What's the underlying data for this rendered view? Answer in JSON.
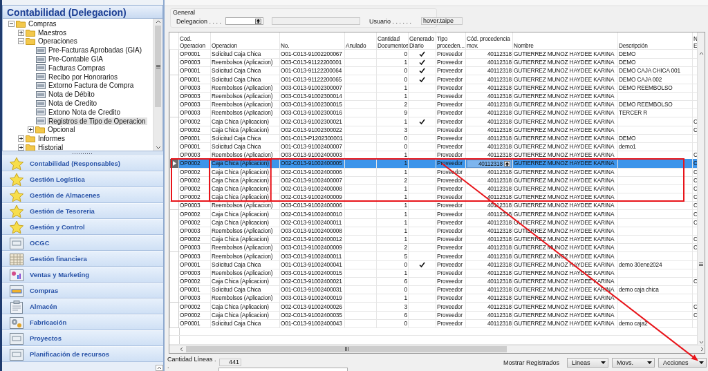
{
  "sidebar": {
    "title": "Contabilidad (Delegacion)",
    "tree": [
      {
        "label": "Compras",
        "kind": "folder",
        "expanded": true,
        "selected": false,
        "children": [
          {
            "label": "Maestros",
            "kind": "folder",
            "expanded": false,
            "selected": false
          },
          {
            "label": "Operaciones",
            "kind": "folder",
            "expanded": true,
            "selected": false,
            "children": [
              {
                "label": "Pre-Facturas Aprobadas (GIA)",
                "kind": "form",
                "selected": false
              },
              {
                "label": "Pre-Contable GIA",
                "kind": "form",
                "selected": false
              },
              {
                "label": "Facturas Compras",
                "kind": "form",
                "selected": false
              },
              {
                "label": "Recibo por Honorarios",
                "kind": "form",
                "selected": false
              },
              {
                "label": "Extorno Factura de Compra",
                "kind": "form",
                "selected": false
              },
              {
                "label": "Nota de Débito",
                "kind": "form",
                "selected": false
              },
              {
                "label": "Nota de Credito",
                "kind": "form",
                "selected": false
              },
              {
                "label": "Extono Nota de Credito",
                "kind": "form",
                "selected": false
              },
              {
                "label": "Registros de Tipo de Operacion",
                "kind": "form",
                "selected": true
              },
              {
                "label": "Opcional",
                "kind": "folder",
                "expanded": false,
                "selected": false
              }
            ]
          },
          {
            "label": "Informes",
            "kind": "folder",
            "expanded": false,
            "selected": false
          },
          {
            "label": "Historial",
            "kind": "folder",
            "expanded": false,
            "selected": false
          }
        ]
      }
    ],
    "nav": [
      {
        "label": "Contabilidad (Responsables)",
        "kind": "star"
      },
      {
        "label": "Gestión Logística",
        "kind": "star"
      },
      {
        "label": "Gestión de Almacenes",
        "kind": "star"
      },
      {
        "label": "Gestión de Tesoreria",
        "kind": "star"
      },
      {
        "label": "Gestión y Control",
        "kind": "star"
      },
      {
        "label": "OCGC",
        "kind": "form"
      },
      {
        "label": "Gestión financiera",
        "kind": "grid"
      },
      {
        "label": "Ventas y Marketing",
        "kind": "chart"
      },
      {
        "label": "Compras",
        "kind": "tray"
      },
      {
        "label": "Almacén",
        "kind": "clipboard"
      },
      {
        "label": "Fabricación",
        "kind": "gear"
      },
      {
        "label": "Proyectos",
        "kind": "form"
      },
      {
        "label": "Planificación de recursos",
        "kind": "form"
      }
    ]
  },
  "general": {
    "title": "General",
    "delegacion_label": "Delegacion . . . .",
    "usuario_label": "Usuario . . . . . .",
    "usuario": "hover.taipe"
  },
  "table": {
    "columns": [
      {
        "label": "Cod.\nOperacion",
        "marked": false
      },
      {
        "label": "Operacion",
        "marked": true
      },
      {
        "label": "No.",
        "marked": false
      },
      {
        "label": "Anulado",
        "marked": false
      },
      {
        "label": "Cantidad\nDocumentos",
        "marked": false
      },
      {
        "label": "Generado\nDiario",
        "marked": false
      },
      {
        "label": "Tipo\nproceden...",
        "marked": false
      },
      {
        "label": "Cód. procedencia\nmov.",
        "marked": false
      },
      {
        "label": "Nombre",
        "marked": false
      },
      {
        "label": "Descripción",
        "marked": false
      },
      {
        "label": "N\nE",
        "marked": false
      }
    ],
    "rows": [
      {
        "code": "OP0001",
        "operacion": "Solicitud Caja Chica",
        "no": "O01-C013-91002200067",
        "cantidad": "0",
        "generado_diario": true,
        "tipo": "Proveedor",
        "cod_procedencia": "40112318",
        "nombre": "GUTIERREZ MUNOZ HAYDEE KARINA",
        "descripcion": "DEMO",
        "selected": false,
        "marked": false
      },
      {
        "code": "OP0003",
        "operacion": "Reembolsos (Aplicacion)",
        "no": "O03-C013-91122200001",
        "cantidad": "1",
        "generado_diario": true,
        "tipo": "Proveedor",
        "cod_procedencia": "40112318",
        "nombre": "GUTIERREZ MUNOZ HAYDEE KARINA",
        "descripcion": "DEMO",
        "selected": false,
        "marked": false
      },
      {
        "code": "OP0001",
        "operacion": "Solicitud Caja Chica",
        "no": "O01-C013-91122200064",
        "cantidad": "0",
        "generado_diario": true,
        "tipo": "Proveedor",
        "cod_procedencia": "40112318",
        "nombre": "GUTIERREZ MUNOZ HAYDEE KARINA",
        "descripcion": "DEMO CAJA CHICA 001",
        "selected": false,
        "marked": false
      },
      {
        "code": "OP0001",
        "operacion": "Solicitud Caja Chica",
        "no": "O01-C013-91122200065",
        "cantidad": "0",
        "generado_diario": true,
        "tipo": "Proveedor",
        "cod_procedencia": "40112318",
        "nombre": "GUTIERREZ MUNOZ HAYDEE KARINA",
        "descripcion": "DEMO CAJA 002",
        "selected": false,
        "marked": false
      },
      {
        "code": "OP0003",
        "operacion": "Reembolsos (Aplicacion)",
        "no": "O03-C013-91002300007",
        "cantidad": "1",
        "generado_diario": false,
        "tipo": "Proveedor",
        "cod_procedencia": "40112318",
        "nombre": "GUTIERREZ MUNOZ HAYDEE KARINA",
        "descripcion": "DEMO REEMBOLSO",
        "selected": false,
        "marked": false
      },
      {
        "code": "OP0003",
        "operacion": "Reembolsos (Aplicacion)",
        "no": "O03-C013-91002300014",
        "cantidad": "1",
        "generado_diario": false,
        "tipo": "Proveedor",
        "cod_procedencia": "40112318",
        "nombre": "GUTIERREZ MUNOZ HAYDEE KARINA",
        "selected": false,
        "marked": false
      },
      {
        "code": "OP0003",
        "operacion": "Reembolsos (Aplicacion)",
        "no": "O03-C013-91002300015",
        "cantidad": "2",
        "generado_diario": false,
        "tipo": "Proveedor",
        "cod_procedencia": "40112318",
        "nombre": "GUTIERREZ MUNOZ HAYDEE KARINA",
        "descripcion": "DEMO REEMBOLSO",
        "selected": false,
        "marked": false
      },
      {
        "code": "OP0003",
        "operacion": "Reembolsos (Aplicacion)",
        "no": "O03-C013-91002300016",
        "cantidad": "9",
        "generado_diario": false,
        "tipo": "Proveedor",
        "cod_procedencia": "40112318",
        "nombre": "GUTIERREZ MUNOZ HAYDEE KARINA",
        "descripcion": "TERCER R",
        "selected": false,
        "marked": false
      },
      {
        "code": "OP0002",
        "operacion": "Caja Chica (Aplicacion)",
        "no": "O02-C013-91002300021",
        "cantidad": "1",
        "generado_diario": true,
        "tipo": "Proveedor",
        "cod_procedencia": "40112318",
        "nombre": "GUTIERREZ MUNOZ HAYDEE KARINA",
        "column_12": "C",
        "selected": false,
        "marked": false
      },
      {
        "code": "OP0002",
        "operacion": "Caja Chica (Aplicacion)",
        "no": "O02-C013-91002300022",
        "cantidad": "3",
        "generado_diario": false,
        "tipo": "Proveedor",
        "cod_procedencia": "40112318",
        "nombre": "GUTIERREZ MUNOZ HAYDEE KARINA",
        "column_12": "C",
        "selected": false,
        "marked": false
      },
      {
        "code": "OP0001",
        "operacion": "Solicitud Caja Chica",
        "no": "O01-C013-P1202300001",
        "cantidad": "0",
        "generado_diario": false,
        "tipo": "Proveedor",
        "cod_procedencia": "40112318",
        "nombre": "GUTIERREZ MUNOZ HAYDEE KARINA",
        "descripcion": "DEMO",
        "selected": false,
        "marked": false
      },
      {
        "code": "OP0001",
        "operacion": "Solicitud Caja Chica",
        "no": "O01-C013-91002400007",
        "cantidad": "0",
        "generado_diario": false,
        "tipo": "Proveedor",
        "cod_procedencia": "40112318",
        "nombre": "GUTIERREZ MUNOZ HAYDEE KARINA",
        "descripcion": "demo1",
        "selected": false,
        "marked": false
      },
      {
        "code": "OP0003",
        "operacion": "Reembolsos (Aplicacion)",
        "no": "O03-C013-91002400003",
        "cantidad": "1",
        "generado_diario": false,
        "tipo": "Proveedor",
        "cod_procedencia": "40112318",
        "nombre": "GUTIERREZ MUNOZ HAYDEE KARINA",
        "column_12": "C",
        "selected": false,
        "marked": false
      },
      {
        "code": "OP0002",
        "operacion": "Caja Chica (Aplicacion)",
        "no": "O02-C013-91002400005",
        "cantidad": "1",
        "generado_diario": false,
        "tipo": "Proveedor",
        "cod_procedencia": "40112318",
        "nombre": "GUTIERREZ MUNOZ HAYDEE KARINA",
        "column_12": "C",
        "selected": true,
        "marked": true
      },
      {
        "code": "OP0002",
        "operacion": "Caja Chica (Aplicacion)",
        "no": "O02-C013-91002400006",
        "cantidad": "1",
        "generado_diario": false,
        "tipo": "Proveedor",
        "cod_procedencia": "40112318",
        "nombre": "GUTIERREZ MUNOZ HAYDEE KARINA",
        "column_12": "C",
        "selected": false,
        "marked": true
      },
      {
        "code": "OP0002",
        "operacion": "Caja Chica (Aplicacion)",
        "no": "O02-C013-91002400007",
        "cantidad": "2",
        "generado_diario": false,
        "tipo": "Proveedor",
        "cod_procedencia": "40112318",
        "nombre": "GUTIERREZ MUNOZ HAYDEE KARINA",
        "column_12": "C",
        "selected": false,
        "marked": true
      },
      {
        "code": "OP0002",
        "operacion": "Caja Chica (Aplicacion)",
        "no": "O02-C013-91002400008",
        "cantidad": "1",
        "generado_diario": false,
        "tipo": "Proveedor",
        "cod_procedencia": "40112318",
        "nombre": "GUTIERREZ MUNOZ HAYDEE KARINA",
        "column_12": "C",
        "selected": false,
        "marked": true
      },
      {
        "code": "OP0002",
        "operacion": "Caja Chica (Aplicacion)",
        "no": "O02-C013-91002400009",
        "cantidad": "1",
        "generado_diario": false,
        "tipo": "Proveedor",
        "cod_procedencia": "40112318",
        "nombre": "GUTIERREZ MUNOZ HAYDEE KARINA",
        "column_12": "C",
        "selected": false,
        "marked": true
      },
      {
        "code": "OP0003",
        "operacion": "Reembolsos (Aplicacion)",
        "no": "O03-C013-91002400006",
        "cantidad": "1",
        "generado_diario": false,
        "tipo": "Proveedor",
        "cod_procedencia": "40112318",
        "nombre": "GUTIERREZ MUNOZ HAYDEE KARINA",
        "column_12": "C",
        "selected": false,
        "marked": false
      },
      {
        "code": "OP0002",
        "operacion": "Caja Chica (Aplicacion)",
        "no": "O02-C013-91002400010",
        "cantidad": "1",
        "generado_diario": false,
        "tipo": "Proveedor",
        "cod_procedencia": "40112318",
        "nombre": "GUTIERREZ MUNOZ HAYDEE KARINA",
        "column_12": "C",
        "selected": false,
        "marked": false
      },
      {
        "code": "OP0002",
        "operacion": "Caja Chica (Aplicacion)",
        "no": "O02-C013-91002400011",
        "cantidad": "1",
        "generado_diario": false,
        "tipo": "Proveedor",
        "cod_procedencia": "40112318",
        "nombre": "GUTIERREZ MUNOZ HAYDEE KARINA",
        "column_12": "C",
        "selected": false,
        "marked": false
      },
      {
        "code": "OP0003",
        "operacion": "Reembolsos (Aplicacion)",
        "no": "O03-C013-91002400008",
        "cantidad": "1",
        "generado_diario": false,
        "tipo": "Proveedor",
        "cod_procedencia": "40112318",
        "nombre": "GUTIERREZ MUNOZ HAYDEE KARINA",
        "selected": false,
        "marked": false
      },
      {
        "code": "OP0002",
        "operacion": "Caja Chica (Aplicacion)",
        "no": "O02-C013-91002400012",
        "cantidad": "1",
        "generado_diario": false,
        "tipo": "Proveedor",
        "cod_procedencia": "40112318",
        "nombre": "GUTIERREZ MUNOZ HAYDEE KARINA",
        "column_12": "C",
        "selected": false,
        "marked": false
      },
      {
        "code": "OP0003",
        "operacion": "Reembolsos (Aplicacion)",
        "no": "O03-C013-91002400009",
        "cantidad": "2",
        "generado_diario": false,
        "tipo": "Proveedor",
        "cod_procedencia": "40112318",
        "nombre": "GUTIERREZ MUNOZ HAYDEE KARINA",
        "column_12": "C",
        "selected": false,
        "marked": false
      },
      {
        "code": "OP0003",
        "operacion": "Reembolsos (Aplicacion)",
        "no": "O03-C013-91002400011",
        "cantidad": "5",
        "generado_diario": false,
        "tipo": "Proveedor",
        "cod_procedencia": "40112318",
        "nombre": "GUTIERREZ MUNOZ HAYDEE KARINA",
        "selected": false,
        "marked": false
      },
      {
        "code": "OP0001",
        "operacion": "Solicitud Caja Chica",
        "no": "O01-C013-91002400041",
        "cantidad": "0",
        "generado_diario": true,
        "tipo": "Proveedor",
        "cod_procedencia": "40112318",
        "nombre": "GUTIERREZ MUNOZ HAYDEE KARINA",
        "descripcion": "demo 30ene2024",
        "selected": false,
        "marked": false
      },
      {
        "code": "OP0003",
        "operacion": "Reembolsos (Aplicacion)",
        "no": "O03-C013-91002400015",
        "cantidad": "1",
        "generado_diario": false,
        "tipo": "Proveedor",
        "cod_procedencia": "40112318",
        "nombre": "GUTIERREZ MUNOZ HAYDEE KARINA",
        "selected": false,
        "marked": false
      },
      {
        "code": "OP0002",
        "operacion": "Caja Chica (Aplicacion)",
        "no": "O02-C013-91002400021",
        "cantidad": "6",
        "generado_diario": false,
        "tipo": "Proveedor",
        "cod_procedencia": "40112318",
        "nombre": "GUTIERREZ MUNOZ HAYDEE KARINA",
        "column_12": "C",
        "selected": false,
        "marked": false
      },
      {
        "code": "OP0001",
        "operacion": "Solicitud Caja Chica",
        "no": "O01-C013-91002400031",
        "cantidad": "0",
        "generado_diario": false,
        "tipo": "Proveedor",
        "cod_procedencia": "40112318",
        "nombre": "GUTIERREZ MUNOZ HAYDEE KARINA",
        "descripcion": "demo caja chica",
        "selected": false,
        "marked": false
      },
      {
        "code": "OP0003",
        "operacion": "Reembolsos (Aplicacion)",
        "no": "O03-C013-91002400019",
        "cantidad": "1",
        "generado_diario": false,
        "tipo": "Proveedor",
        "cod_procedencia": "40112318",
        "nombre": "GUTIERREZ MUNOZ HAYDEE KARINA",
        "selected": false,
        "marked": false
      },
      {
        "code": "OP0002",
        "operacion": "Caja Chica (Aplicacion)",
        "no": "O02-C013-91002400026",
        "cantidad": "3",
        "generado_diario": false,
        "tipo": "Proveedor",
        "cod_procedencia": "40112318",
        "nombre": "GUTIERREZ MUNOZ HAYDEE KARINA",
        "column_12": "C",
        "selected": false,
        "marked": false
      },
      {
        "code": "OP0002",
        "operacion": "Caja Chica (Aplicacion)",
        "no": "O02-C013-91002400035",
        "cantidad": "6",
        "generado_diario": false,
        "tipo": "Proveedor",
        "cod_procedencia": "40112318",
        "nombre": "GUTIERREZ MUNOZ HAYDEE KARINA",
        "column_12": "C",
        "selected": false,
        "marked": false
      },
      {
        "code": "OP0001",
        "operacion": "Solicitud Caja Chica",
        "no": "O01-C013-91002400043",
        "cantidad": "0",
        "generado_diario": false,
        "tipo": "Proveedor",
        "cod_procedencia": "40112318",
        "nombre": "GUTIERREZ MUNOZ HAYDEE KARINA",
        "descripcion": "demo caja2",
        "selected": false,
        "marked": false
      }
    ]
  },
  "footer": {
    "count_label": "Cantidad Líneas . .",
    "count": "441",
    "mostrar_label": "Mostrar Registrados",
    "buttons": [
      {
        "label": "Lineas",
        "arrow_target": false
      },
      {
        "label": "Movs.",
        "arrow_target": false
      },
      {
        "label": "Acciones",
        "arrow_target": true
      }
    ]
  }
}
